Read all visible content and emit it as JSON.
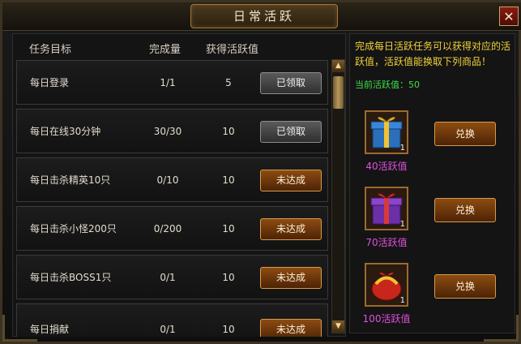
{
  "window": {
    "title": "日常活跃",
    "close_label": "✕"
  },
  "table": {
    "headers": {
      "task": "任务目标",
      "progress": "完成量",
      "points": "获得活跃值"
    },
    "rows": [
      {
        "name": "每日登录",
        "progress": "1/1",
        "points": "5",
        "button": "已领取",
        "state": "claimed"
      },
      {
        "name": "每日在线30分钟",
        "progress": "30/30",
        "points": "10",
        "button": "已领取",
        "state": "claimed"
      },
      {
        "name": "每日击杀精英10只",
        "progress": "0/10",
        "points": "10",
        "button": "未达成",
        "state": "locked"
      },
      {
        "name": "每日击杀小怪200只",
        "progress": "0/200",
        "points": "10",
        "button": "未达成",
        "state": "locked"
      },
      {
        "name": "每日击杀BOSS1只",
        "progress": "0/1",
        "points": "10",
        "button": "未达成",
        "state": "locked"
      },
      {
        "name": "每日捐献",
        "progress": "0/1",
        "points": "10",
        "button": "未达成",
        "state": "locked"
      }
    ]
  },
  "scrollbar": {
    "up": "▲",
    "down": "▼"
  },
  "side": {
    "description": "完成每日活跃任务可以获得对应的活跃值，活跃值能换取下列商品！",
    "current_points_label": "当前活跃值：",
    "current_points": "50",
    "rewards": [
      {
        "cost": "40活跃值",
        "qty": "1",
        "button": "兑换",
        "icon": "gift-box-blue-icon"
      },
      {
        "cost": "70活跃值",
        "qty": "1",
        "button": "兑换",
        "icon": "gift-box-purple-icon"
      },
      {
        "cost": "100活跃值",
        "qty": "1",
        "button": "兑换",
        "icon": "gift-box-red-icon"
      }
    ]
  }
}
